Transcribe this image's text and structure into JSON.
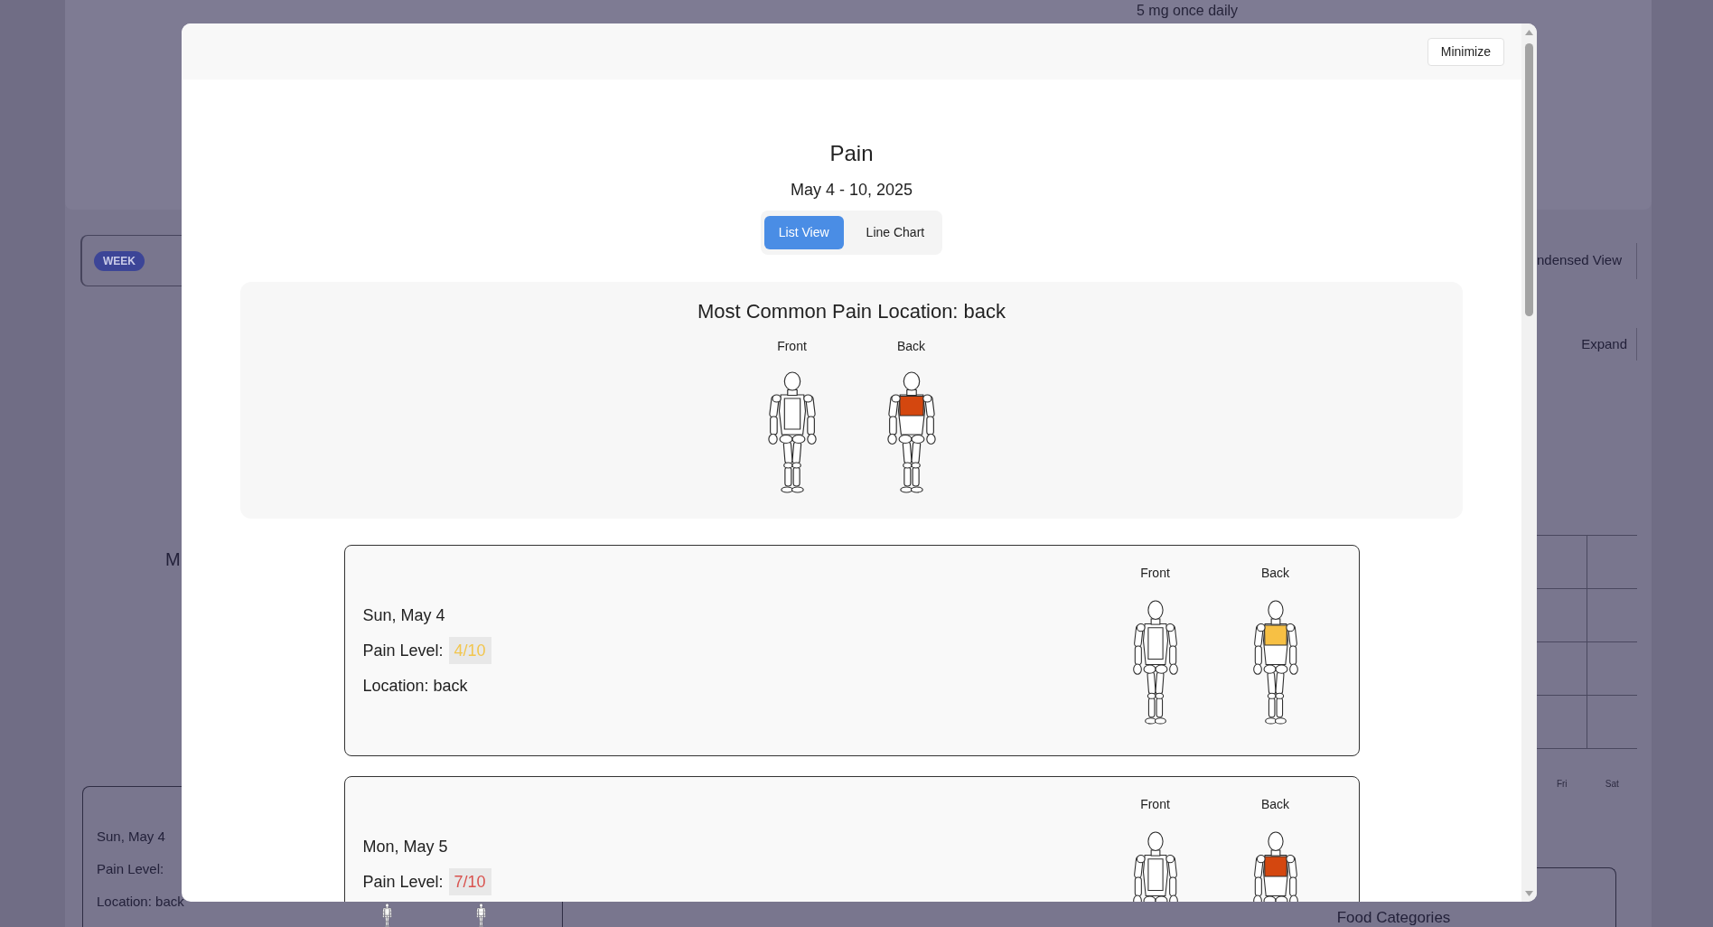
{
  "background": {
    "dose_text": "5 mg once daily",
    "week_badge": "WEEK",
    "condensed_view_button": "ndensed View",
    "expand_button": "Expand",
    "cut_heading": "M",
    "calendar_days": [
      "Fri",
      "Sat"
    ],
    "entry": {
      "date": "Sun, May 4",
      "pain_level_label": "Pain Level:",
      "location": "Location: back",
      "figures": [
        {
          "kind": "front"
        },
        {
          "kind": "back"
        }
      ]
    },
    "food_heading": "Food Categories"
  },
  "modal": {
    "minimize_button": "Minimize",
    "title": "Pain",
    "date_range": "May 4 - 10, 2025",
    "view_tabs": [
      {
        "label": "List View",
        "selected": true
      },
      {
        "label": "Line Chart",
        "selected": false
      }
    ],
    "summary": {
      "heading": "Most Common Pain Location: back",
      "figures": [
        {
          "label": "Front",
          "kind": "front"
        },
        {
          "label": "Back",
          "kind": "back",
          "color": "#d4470f"
        }
      ]
    },
    "entries": [
      {
        "date": "Sun, May 4",
        "pain_level_label": "Pain Level:",
        "pain_level": "4/10",
        "color": "#f2c64e",
        "location": "Location: back",
        "figures": [
          {
            "label": "Front",
            "kind": "front"
          },
          {
            "label": "Back",
            "kind": "back",
            "color": "#f7c044"
          }
        ]
      },
      {
        "date": "Mon, May 5",
        "pain_level_label": "Pain Level:",
        "pain_level": "7/10",
        "color": "#d9534f",
        "figures": [
          {
            "label": "Front",
            "kind": "front"
          },
          {
            "label": "Back",
            "kind": "back",
            "color": "#d4470f"
          }
        ]
      }
    ]
  }
}
